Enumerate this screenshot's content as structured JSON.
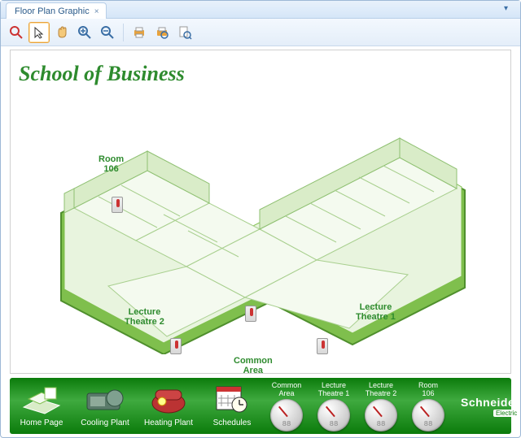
{
  "tab": {
    "title": "Floor Plan Graphic"
  },
  "toolbar": {
    "tools": [
      {
        "name": "connect-icon",
        "glyph": "🔍",
        "color": "#c33"
      },
      {
        "name": "pointer-icon",
        "glyph": "↖",
        "color": "#e8a23c",
        "active": true
      },
      {
        "name": "pan-icon",
        "glyph": "✋",
        "color": "#e8a23c"
      },
      {
        "name": "zoom-in-icon",
        "glyph": "🔍+",
        "color": "#3a6ea5"
      },
      {
        "name": "zoom-out-icon",
        "glyph": "🔍−",
        "color": "#3a6ea5"
      },
      {
        "sep": true
      },
      {
        "name": "print-icon",
        "glyph": "🖨",
        "color": "#3a6ea5"
      },
      {
        "name": "print-preview-icon",
        "glyph": "🖨",
        "color": "#3a6ea5"
      },
      {
        "name": "page-preview-icon",
        "glyph": "🔎",
        "color": "#3a6ea5"
      }
    ]
  },
  "page": {
    "title": "School of Business"
  },
  "rooms": {
    "r106": "Room\n106",
    "lect2": "Lecture\nTheatre 2",
    "lect1": "Lecture\nTheatre 1",
    "common": "Common\nArea"
  },
  "footer": {
    "nav": [
      {
        "id": "home",
        "label": "Home Page"
      },
      {
        "id": "cooling",
        "label": "Cooling Plant"
      },
      {
        "id": "heating",
        "label": "Heating Plant"
      },
      {
        "id": "schedules",
        "label": "Schedules"
      }
    ],
    "gauges": [
      {
        "id": "common",
        "label": "Common\nArea",
        "value": "88"
      },
      {
        "id": "lect1",
        "label": "Lecture\nTheatre 1",
        "value": "88"
      },
      {
        "id": "lect2",
        "label": "Lecture\nTheatre 2",
        "value": "88"
      },
      {
        "id": "r106",
        "label": "Room\n106",
        "value": "88"
      }
    ],
    "brand": {
      "name": "Schneider",
      "sub": "Electric"
    }
  }
}
